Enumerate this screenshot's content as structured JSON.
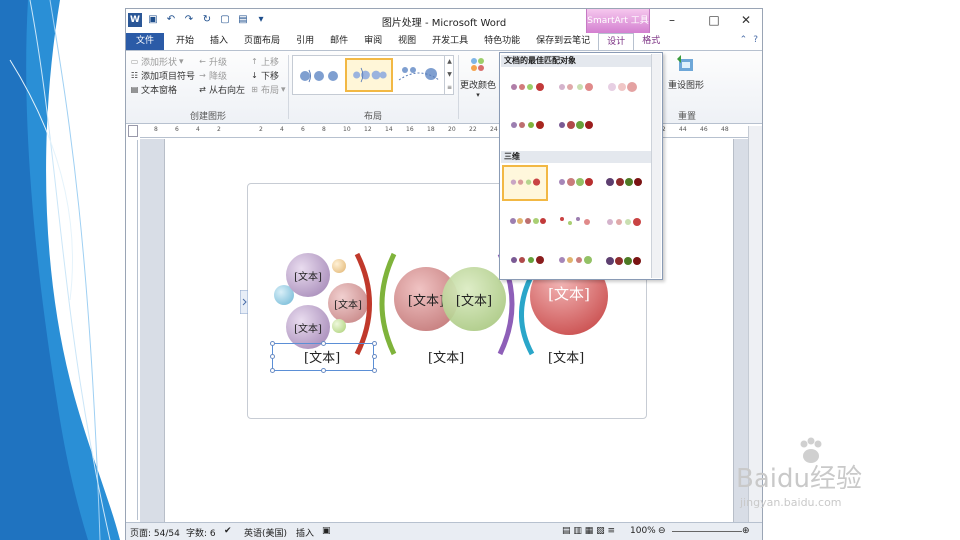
{
  "window": {
    "title": "图片处理 - Microsoft Word",
    "contextual_tab_group": "SmartArt 工具",
    "controls": [
      "–",
      "□",
      "✕"
    ]
  },
  "tabs": [
    "文件",
    "开始",
    "插入",
    "页面布局",
    "引用",
    "邮件",
    "审阅",
    "视图",
    "开发工具",
    "特色功能",
    "保存到云笔记",
    "设计",
    "格式"
  ],
  "ribbon": {
    "create_graphic": {
      "label": "创建图形",
      "add_shape": "添加形状",
      "add_bullet": "添加项目符号",
      "text_pane": "文本窗格",
      "promote": "升级",
      "demote": "降级",
      "right_to_left": "从右向左",
      "move_up": "上移",
      "move_down": "下移",
      "layout_btn": "布局"
    },
    "layouts_label": "布局",
    "change_colors": "更改颜色",
    "reset": {
      "label": "重置",
      "reset_graphic": "重设图形"
    }
  },
  "dropdown": {
    "section1": "文档的最佳匹配对象",
    "section2": "三维"
  },
  "ruler_marks": [
    "8",
    "6",
    "4",
    "2",
    "",
    "2",
    "4",
    "6",
    "8",
    "10",
    "12",
    "14",
    "16",
    "18",
    "20",
    "22",
    "24",
    "",
    "",
    "",
    "",
    "",
    "",
    "",
    "42",
    "44",
    "46",
    "48"
  ],
  "smartart": {
    "placeholder": "[文本]",
    "left_labels": [
      "[文本]",
      "[文本]",
      "[文本]"
    ],
    "mid_labels": [
      "[文本]",
      "[文本]"
    ],
    "right_label": "[文本]",
    "bottom_labels": [
      "[文本]",
      "[文本]",
      "[文本]"
    ]
  },
  "status": {
    "page": "页面: 54/54",
    "words": "字数: 6",
    "language": "英语(美国)",
    "mode": "插入",
    "zoom": "100%"
  },
  "watermark": {
    "brand": "Baidu经验",
    "url": "jingyan.baidu.com"
  },
  "colors": {
    "file_tab": "#2b5ba7",
    "contextual": "#d37fd0",
    "selection": "#f2b844"
  }
}
